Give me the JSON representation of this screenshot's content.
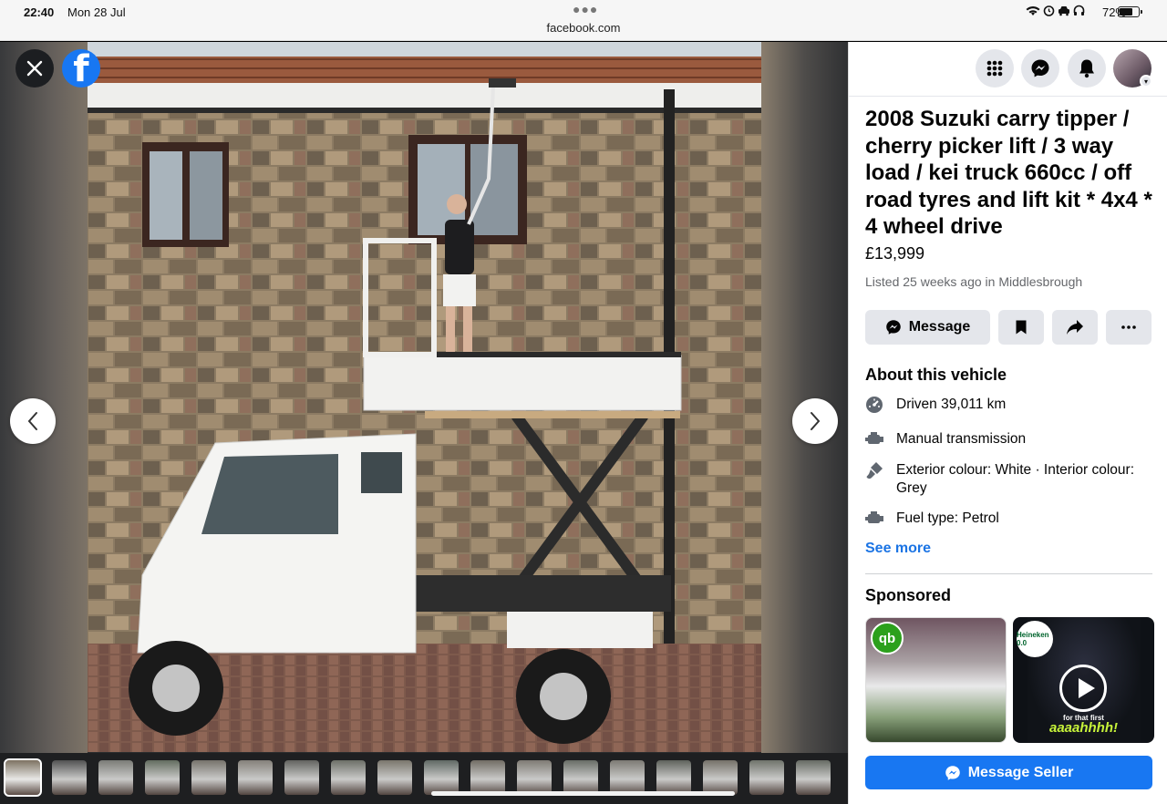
{
  "status_bar": {
    "time": "22:40",
    "date": "Mon 28 Jul",
    "url": "facebook.com",
    "battery": "72%",
    "battery_level": 0.72
  },
  "viewer": {
    "close_icon": "close-icon",
    "logo_icon": "facebook-logo-icon",
    "prev_icon": "chevron-left-icon",
    "next_icon": "chevron-right-icon",
    "thumbnail_count": 18
  },
  "header_icons": [
    "grid-menu-icon",
    "messenger-icon",
    "bell-icon",
    "profile-avatar"
  ],
  "listing": {
    "title": "2008 Suzuki carry tipper / cherry picker lift / 3 way load / kei truck 660cc / off road tyres and lift kit * 4x4 * 4 wheel drive",
    "price": "£13,999",
    "listed": "Listed 25 weeks ago in Middlesbrough"
  },
  "actions": {
    "message_label": "Message",
    "save_icon": "bookmark-icon",
    "share_icon": "share-icon",
    "more_icon": "more-icon"
  },
  "about": {
    "heading": "About this vehicle",
    "specs": [
      {
        "icon": "speedometer-icon",
        "text": "Driven 39,011 km"
      },
      {
        "icon": "engine-icon",
        "text": "Manual transmission"
      },
      {
        "icon": "paint-icon",
        "text": "Exterior colour: White · Interior colour: Grey"
      },
      {
        "icon": "fuel-icon",
        "text": "Fuel type: Petrol"
      }
    ],
    "see_more": "See more"
  },
  "sponsored": {
    "heading": "Sponsored",
    "ads": [
      {
        "badge": "qb"
      },
      {
        "badge": "Heineken 0.0",
        "subtitle": "for that first",
        "headline": "aaaahhhh!"
      }
    ]
  },
  "cta": {
    "label": "Message Seller"
  },
  "colors": {
    "brand": "#1877f2",
    "link": "#1b74e4",
    "button_bg": "#e4e6eb"
  }
}
